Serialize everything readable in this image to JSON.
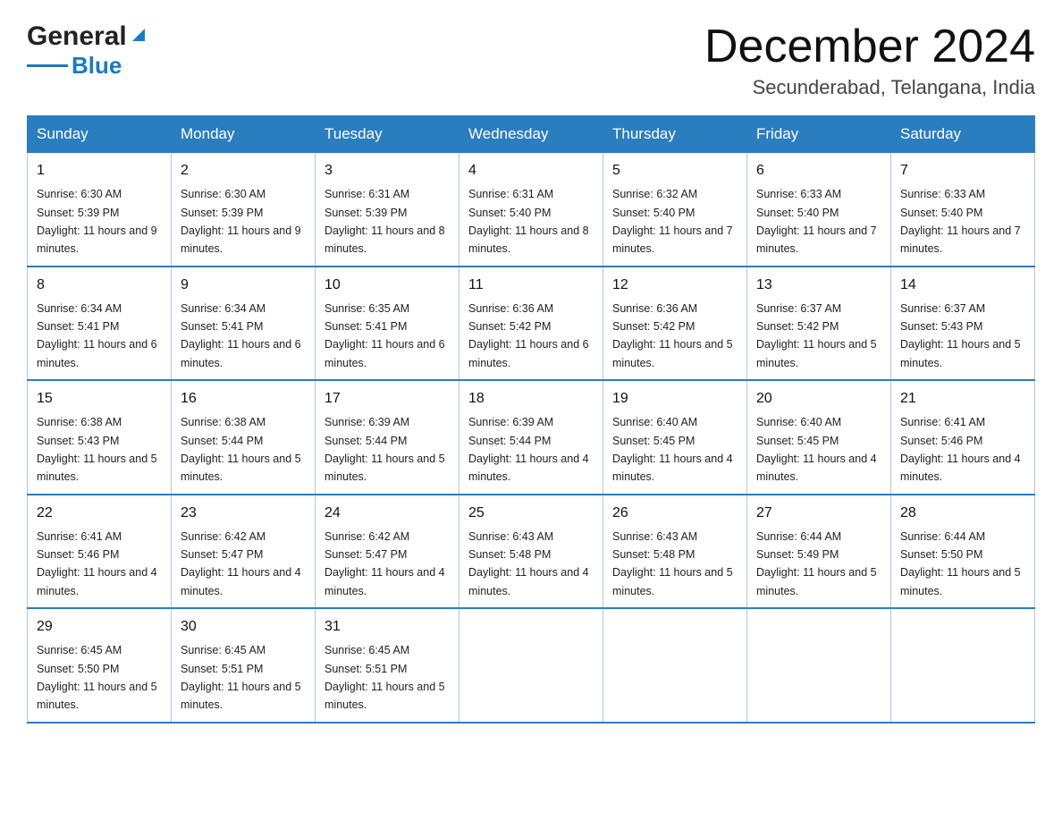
{
  "header": {
    "logo_general": "General",
    "logo_blue": "Blue",
    "calendar_title": "December 2024",
    "calendar_subtitle": "Secunderabad, Telangana, India"
  },
  "days_of_week": [
    "Sunday",
    "Monday",
    "Tuesday",
    "Wednesday",
    "Thursday",
    "Friday",
    "Saturday"
  ],
  "weeks": [
    [
      {
        "day": 1,
        "sunrise": "6:30 AM",
        "sunset": "5:39 PM",
        "daylight": "11 hours and 9 minutes."
      },
      {
        "day": 2,
        "sunrise": "6:30 AM",
        "sunset": "5:39 PM",
        "daylight": "11 hours and 9 minutes."
      },
      {
        "day": 3,
        "sunrise": "6:31 AM",
        "sunset": "5:39 PM",
        "daylight": "11 hours and 8 minutes."
      },
      {
        "day": 4,
        "sunrise": "6:31 AM",
        "sunset": "5:40 PM",
        "daylight": "11 hours and 8 minutes."
      },
      {
        "day": 5,
        "sunrise": "6:32 AM",
        "sunset": "5:40 PM",
        "daylight": "11 hours and 7 minutes."
      },
      {
        "day": 6,
        "sunrise": "6:33 AM",
        "sunset": "5:40 PM",
        "daylight": "11 hours and 7 minutes."
      },
      {
        "day": 7,
        "sunrise": "6:33 AM",
        "sunset": "5:40 PM",
        "daylight": "11 hours and 7 minutes."
      }
    ],
    [
      {
        "day": 8,
        "sunrise": "6:34 AM",
        "sunset": "5:41 PM",
        "daylight": "11 hours and 6 minutes."
      },
      {
        "day": 9,
        "sunrise": "6:34 AM",
        "sunset": "5:41 PM",
        "daylight": "11 hours and 6 minutes."
      },
      {
        "day": 10,
        "sunrise": "6:35 AM",
        "sunset": "5:41 PM",
        "daylight": "11 hours and 6 minutes."
      },
      {
        "day": 11,
        "sunrise": "6:36 AM",
        "sunset": "5:42 PM",
        "daylight": "11 hours and 6 minutes."
      },
      {
        "day": 12,
        "sunrise": "6:36 AM",
        "sunset": "5:42 PM",
        "daylight": "11 hours and 5 minutes."
      },
      {
        "day": 13,
        "sunrise": "6:37 AM",
        "sunset": "5:42 PM",
        "daylight": "11 hours and 5 minutes."
      },
      {
        "day": 14,
        "sunrise": "6:37 AM",
        "sunset": "5:43 PM",
        "daylight": "11 hours and 5 minutes."
      }
    ],
    [
      {
        "day": 15,
        "sunrise": "6:38 AM",
        "sunset": "5:43 PM",
        "daylight": "11 hours and 5 minutes."
      },
      {
        "day": 16,
        "sunrise": "6:38 AM",
        "sunset": "5:44 PM",
        "daylight": "11 hours and 5 minutes."
      },
      {
        "day": 17,
        "sunrise": "6:39 AM",
        "sunset": "5:44 PM",
        "daylight": "11 hours and 5 minutes."
      },
      {
        "day": 18,
        "sunrise": "6:39 AM",
        "sunset": "5:44 PM",
        "daylight": "11 hours and 4 minutes."
      },
      {
        "day": 19,
        "sunrise": "6:40 AM",
        "sunset": "5:45 PM",
        "daylight": "11 hours and 4 minutes."
      },
      {
        "day": 20,
        "sunrise": "6:40 AM",
        "sunset": "5:45 PM",
        "daylight": "11 hours and 4 minutes."
      },
      {
        "day": 21,
        "sunrise": "6:41 AM",
        "sunset": "5:46 PM",
        "daylight": "11 hours and 4 minutes."
      }
    ],
    [
      {
        "day": 22,
        "sunrise": "6:41 AM",
        "sunset": "5:46 PM",
        "daylight": "11 hours and 4 minutes."
      },
      {
        "day": 23,
        "sunrise": "6:42 AM",
        "sunset": "5:47 PM",
        "daylight": "11 hours and 4 minutes."
      },
      {
        "day": 24,
        "sunrise": "6:42 AM",
        "sunset": "5:47 PM",
        "daylight": "11 hours and 4 minutes."
      },
      {
        "day": 25,
        "sunrise": "6:43 AM",
        "sunset": "5:48 PM",
        "daylight": "11 hours and 4 minutes."
      },
      {
        "day": 26,
        "sunrise": "6:43 AM",
        "sunset": "5:48 PM",
        "daylight": "11 hours and 5 minutes."
      },
      {
        "day": 27,
        "sunrise": "6:44 AM",
        "sunset": "5:49 PM",
        "daylight": "11 hours and 5 minutes."
      },
      {
        "day": 28,
        "sunrise": "6:44 AM",
        "sunset": "5:50 PM",
        "daylight": "11 hours and 5 minutes."
      }
    ],
    [
      {
        "day": 29,
        "sunrise": "6:45 AM",
        "sunset": "5:50 PM",
        "daylight": "11 hours and 5 minutes."
      },
      {
        "day": 30,
        "sunrise": "6:45 AM",
        "sunset": "5:51 PM",
        "daylight": "11 hours and 5 minutes."
      },
      {
        "day": 31,
        "sunrise": "6:45 AM",
        "sunset": "5:51 PM",
        "daylight": "11 hours and 5 minutes."
      },
      null,
      null,
      null,
      null
    ]
  ]
}
